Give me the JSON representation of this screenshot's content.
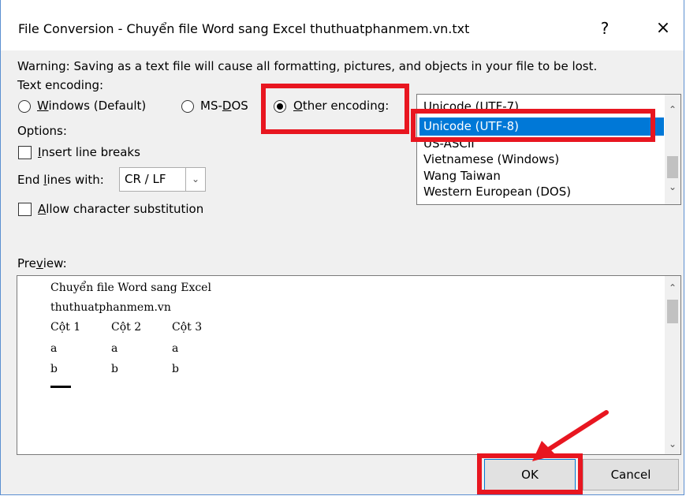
{
  "dialog": {
    "title": "File Conversion - Chuyển file Word sang Excel thuthuatphanmem.vn.txt",
    "help_label": "?",
    "close_label": "×"
  },
  "warning": "Warning: Saving as a text file will cause all formatting, pictures, and objects in your file to be lost.",
  "encoding": {
    "label": "Text encoding:",
    "windows_label": "Windows (Default)",
    "msdos_label": "MS-DOS",
    "other_label": "Other encoding:",
    "selected": "Other encoding",
    "list": {
      "items": [
        "Unicode (UTF-7)",
        "Unicode (UTF-8)",
        "US-ASCII",
        "Vietnamese (Windows)",
        "Wang Taiwan",
        "Western European (DOS)"
      ],
      "selected": "Unicode (UTF-8)"
    }
  },
  "options": {
    "label": "Options:",
    "insert_line_breaks": "Insert line breaks",
    "end_lines_label": "End lines with:",
    "end_lines_value": "CR / LF",
    "allow_substitution": "Allow character substitution"
  },
  "preview": {
    "label": "Preview:",
    "lines": {
      "line1": "Chuyển file Word sang Excel",
      "line2": "thuthuatphanmem.vn",
      "header": [
        "Cột 1",
        "Cột 2",
        "Cột 3"
      ],
      "row1": [
        "a",
        "a",
        "a"
      ],
      "row2": [
        "b",
        "b",
        "b"
      ]
    }
  },
  "buttons": {
    "ok": "OK",
    "cancel": "Cancel"
  },
  "colors": {
    "highlight": "#e81620",
    "selection": "#0078d7"
  }
}
